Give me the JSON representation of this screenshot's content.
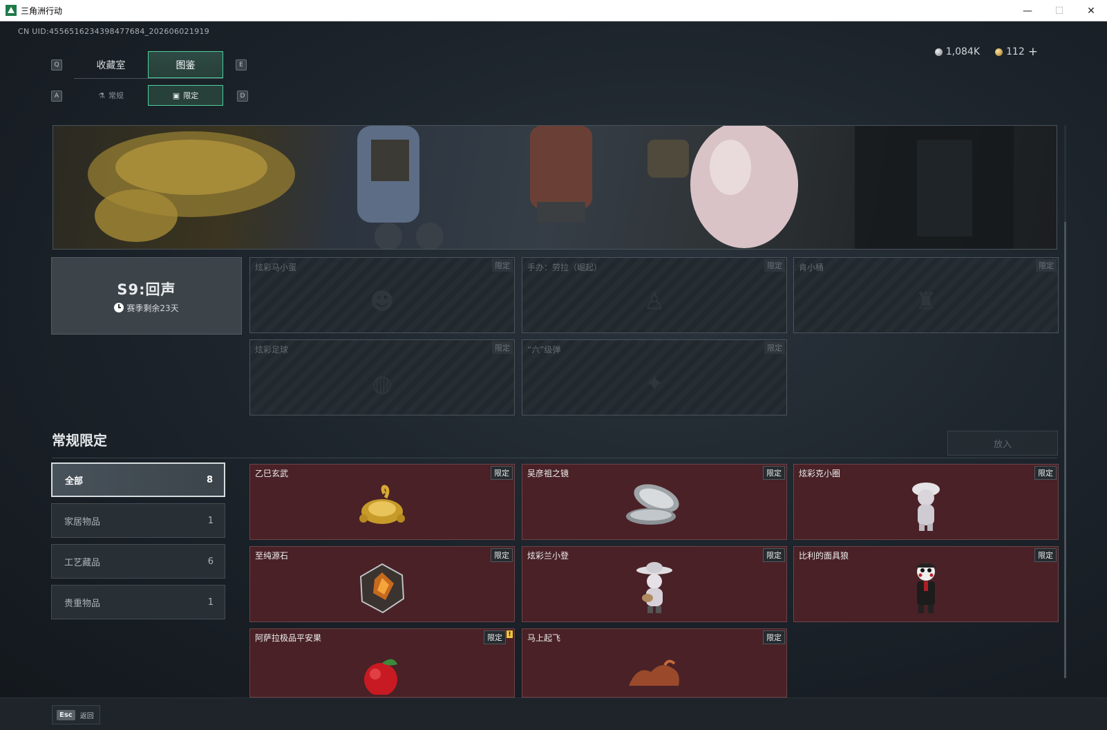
{
  "window": {
    "title": "三角洲行动",
    "minimize": "—",
    "maximize": "☐",
    "close": "✕"
  },
  "uid": "CN UID:4556516234398477684_202606021919",
  "currency": {
    "silver": "1,084K",
    "gold": "112",
    "plus": "+"
  },
  "keys": {
    "q": "Q",
    "e": "E",
    "a": "A",
    "d": "D"
  },
  "tabs_main": [
    {
      "label": "收藏室"
    },
    {
      "label": "图鉴"
    }
  ],
  "tabs_sub": [
    {
      "label": "常规",
      "icon": "flask-icon"
    },
    {
      "label": "限定",
      "icon": "image-icon"
    }
  ],
  "season": {
    "title": "S9:回声",
    "remaining": "赛季剩余23天"
  },
  "limited_cards": [
    {
      "name": "炫彩马小蛋",
      "badge": "限定"
    },
    {
      "name": "手办：劳拉（崛起）",
      "badge": "限定"
    },
    {
      "name": "肯小桶",
      "badge": "限定"
    },
    {
      "name": "炫彩足球",
      "badge": "限定"
    },
    {
      "name": "“六”级弹",
      "badge": "限定"
    }
  ],
  "section": {
    "title": "常规限定",
    "put_in": "放入"
  },
  "filters": [
    {
      "label": "全部",
      "count": "8"
    },
    {
      "label": "家居物品",
      "count": "1"
    },
    {
      "label": "工艺藏品",
      "count": "6"
    },
    {
      "label": "贵重物品",
      "count": "1"
    }
  ],
  "items": [
    {
      "name": "乙巳玄武",
      "badge": "限定"
    },
    {
      "name": "吴彦祖之镜",
      "badge": "限定"
    },
    {
      "name": "炫彩克小圈",
      "badge": "限定"
    },
    {
      "name": "至纯源石",
      "badge": "限定"
    },
    {
      "name": "炫彩兰小登",
      "badge": "限定"
    },
    {
      "name": "比利的面具狼",
      "badge": "限定"
    },
    {
      "name": "阿萨拉极品平安果",
      "badge": "限定",
      "new_flag": "!"
    },
    {
      "name": "马上起飞",
      "badge": "限定"
    }
  ],
  "bottom": {
    "esc_key": "Esc",
    "back_label": "返回"
  }
}
